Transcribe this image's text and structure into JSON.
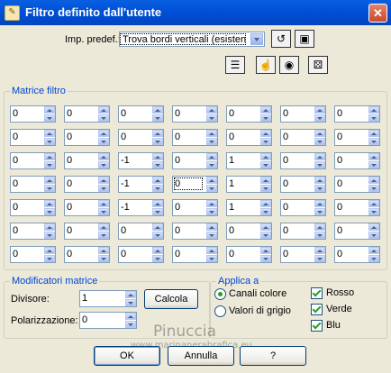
{
  "window": {
    "title": "Filtro definito dall'utente",
    "close_glyph": "✕"
  },
  "preset": {
    "label": "Imp. predef.:",
    "value": "Trova bordi verticali (esisten..."
  },
  "toolbar": {
    "icons": [
      "reset-icon",
      "save-icon",
      "display-icon",
      "proof-icon",
      "eye-icon",
      "randomize-icon"
    ]
  },
  "matrix": {
    "label": "Matrice filtro",
    "rows": [
      [
        "0",
        "0",
        "0",
        "0",
        "0",
        "0",
        "0"
      ],
      [
        "0",
        "0",
        "0",
        "0",
        "0",
        "0",
        "0"
      ],
      [
        "0",
        "0",
        "-1",
        "0",
        "1",
        "0",
        "0"
      ],
      [
        "0",
        "0",
        "-1",
        "0",
        "1",
        "0",
        "0"
      ],
      [
        "0",
        "0",
        "-1",
        "0",
        "1",
        "0",
        "0"
      ],
      [
        "0",
        "0",
        "0",
        "0",
        "0",
        "0",
        "0"
      ],
      [
        "0",
        "0",
        "0",
        "0",
        "0",
        "0",
        "0"
      ]
    ]
  },
  "modifiers": {
    "label": "Modificatori matrice",
    "divisor_label": "Divisore:",
    "divisor_value": "1",
    "bias_label": "Polarizzazione:",
    "bias_value": "0",
    "calc_label": "Calcola"
  },
  "apply": {
    "label": "Applica a",
    "radio_color": "Canali colore",
    "radio_gray": "Valori di grigio",
    "check_red": "Rosso",
    "check_green": "Verde",
    "check_blue": "Blu"
  },
  "buttons": {
    "ok": "OK",
    "cancel": "Annulla",
    "help": "?"
  },
  "watermark": {
    "line1": "Pinuccia",
    "line2": "www.marinanerabrafica.eu"
  }
}
